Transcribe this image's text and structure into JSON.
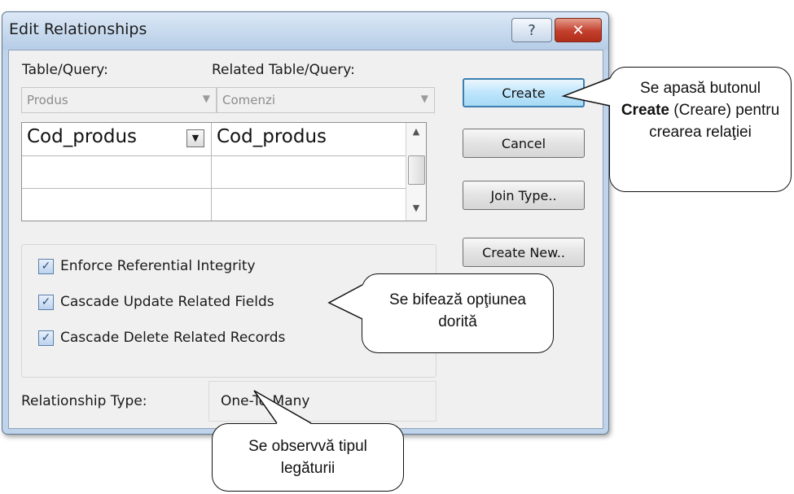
{
  "window": {
    "title": "Edit Relationships",
    "help_glyph": "?",
    "close_glyph": "✕"
  },
  "labels": {
    "table_query": "Table/Query:",
    "related_table_query": "Related Table/Query:",
    "relationship_type": "Relationship Type:"
  },
  "combos": {
    "table_value": "Produs",
    "related_value": "Comenzi"
  },
  "fields_grid": {
    "rows": [
      {
        "left": "Cod_produs",
        "right": "Cod_produs"
      },
      {
        "left": "",
        "right": ""
      },
      {
        "left": "",
        "right": ""
      }
    ]
  },
  "options": [
    {
      "label": "Enforce Referential Integrity",
      "checked": true
    },
    {
      "label": "Cascade Update Related Fields",
      "checked": true
    },
    {
      "label": "Cascade Delete Related Records",
      "checked": true
    }
  ],
  "relationship_type_value": "One-To-Many",
  "buttons": {
    "create": "Create",
    "cancel": "Cancel",
    "join_type": "Join Type..",
    "create_new": "Create New.."
  },
  "callouts": {
    "create": {
      "pre": "Se apasă butonul",
      "bold": "Create",
      "post": "(Creare) pentru crearea relaţiei"
    },
    "options": "Se bifează opţiunea dorită",
    "type": "Se observvă tipul legăturii"
  }
}
